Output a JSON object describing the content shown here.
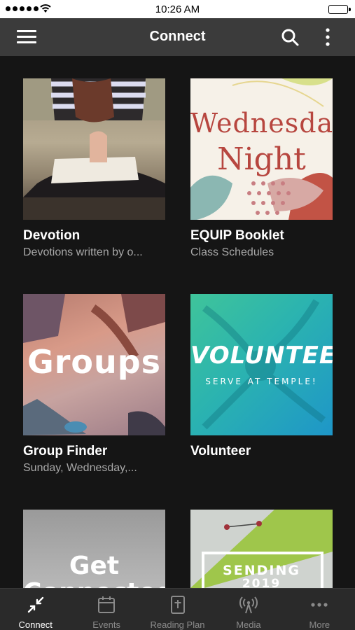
{
  "status_bar": {
    "time": "10:26 AM"
  },
  "nav": {
    "title": "Connect"
  },
  "cards": [
    {
      "title": "Devotion",
      "subtitle": "Devotions written by o..."
    },
    {
      "title": "EQUIP Booklet",
      "subtitle": "Class Schedules",
      "image_text": [
        "Wednesday",
        "Night"
      ]
    },
    {
      "title": "Group Finder",
      "subtitle": "Sunday, Wednesday,...",
      "image_text": [
        "Groups"
      ]
    },
    {
      "title": "Volunteer",
      "subtitle": "",
      "image_text": [
        "VOLUNTEER",
        "SERVE AT TEMPLE!"
      ]
    },
    {
      "title": "",
      "subtitle": "",
      "image_text": [
        "Get",
        "Connected"
      ]
    },
    {
      "title": "",
      "subtitle": "",
      "image_text": [
        "SENDING",
        "2019"
      ]
    }
  ],
  "tabs": [
    {
      "label": "Connect",
      "icon": "collapse-arrows-icon",
      "active": true
    },
    {
      "label": "Events",
      "icon": "calendar-icon",
      "active": false
    },
    {
      "label": "Reading Plan",
      "icon": "bible-icon",
      "active": false
    },
    {
      "label": "Media",
      "icon": "broadcast-icon",
      "active": false
    },
    {
      "label": "More",
      "icon": "ellipsis-icon",
      "active": false
    }
  ],
  "colors": {
    "background": "#151515",
    "nav_bar": "#3b3b3b",
    "tab_bar": "#2a2a2a",
    "subtitle_text": "#a8a8a8",
    "inactive_tab": "#8a8a8a"
  }
}
